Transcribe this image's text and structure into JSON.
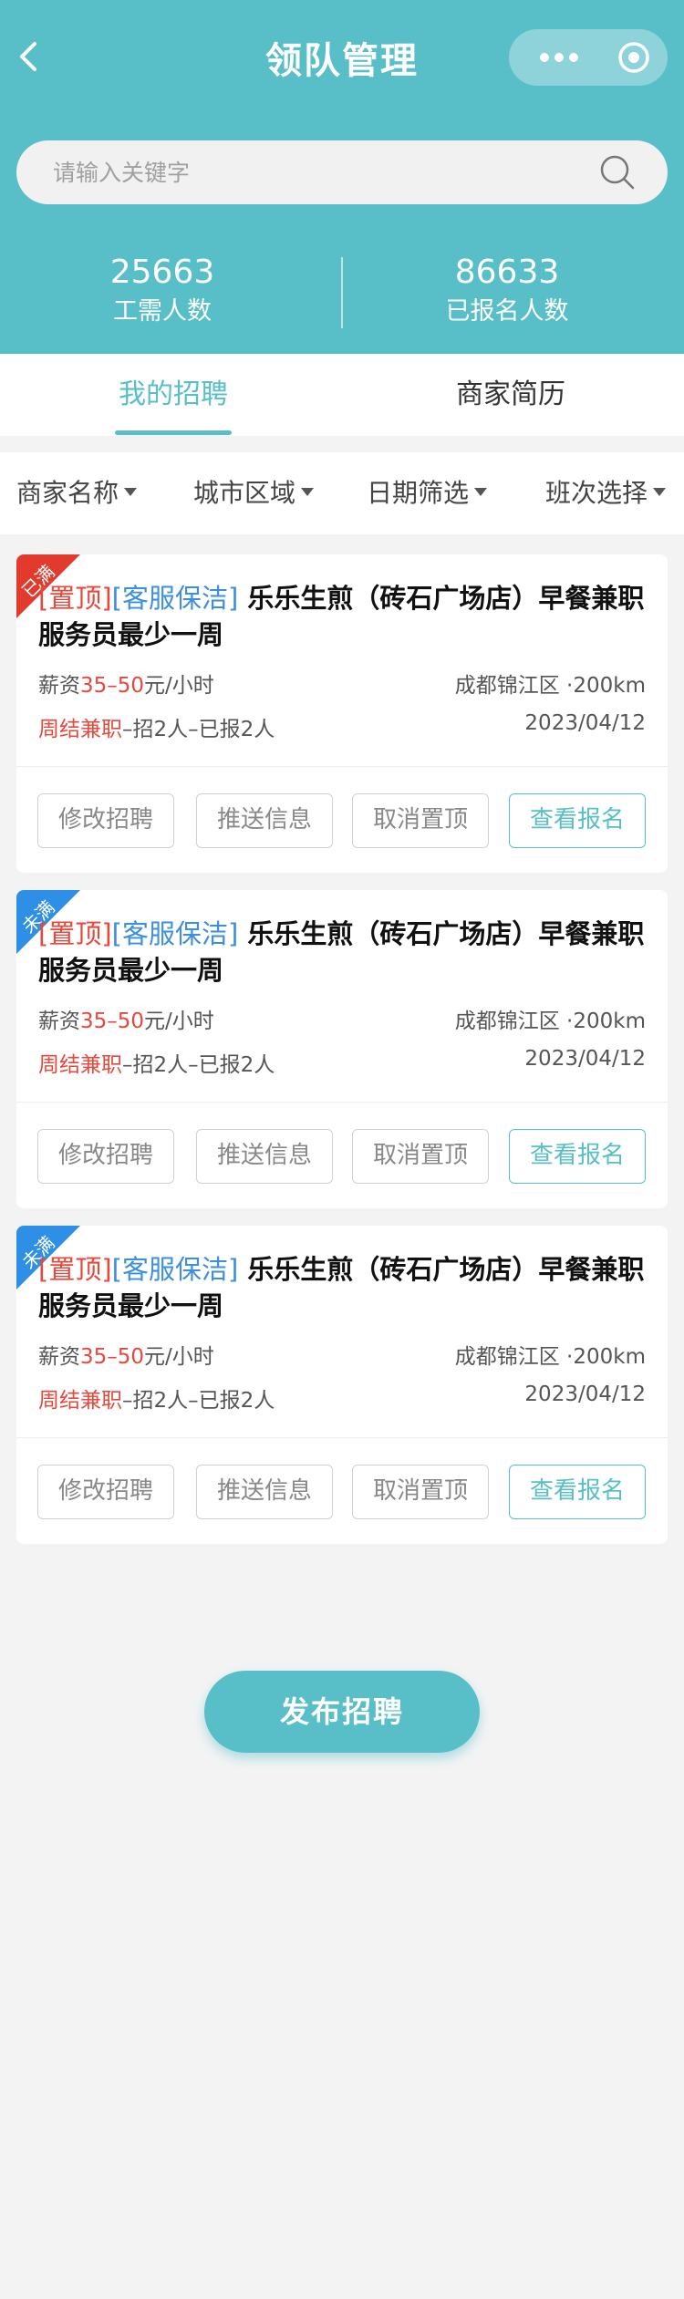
{
  "header": {
    "title": "领队管理",
    "back_icon": "chevron-left-icon",
    "more_icon": "more-dots-icon",
    "target_icon": "target-circle-icon",
    "bg_color": "#58bfc8"
  },
  "search": {
    "placeholder": "请输入关键字",
    "value": ""
  },
  "stats": [
    {
      "value": "25663",
      "label": "工需人数"
    },
    {
      "value": "86633",
      "label": "已报名人数"
    }
  ],
  "tabs": [
    {
      "label": "我的招聘",
      "active": true
    },
    {
      "label": "商家简历",
      "active": false
    }
  ],
  "filters": [
    {
      "label": "商家名称"
    },
    {
      "label": "城市区域"
    },
    {
      "label": "日期筛选"
    },
    {
      "label": "班次选择"
    }
  ],
  "cards": [
    {
      "ribbon": "已满",
      "ribbon_color": "#e23b2e",
      "top_tag": "[置顶]",
      "category": "[客服保洁]",
      "title": "乐乐生煎（砖石广场店）早餐兼职服务员最少一周",
      "salary_prefix": "薪资",
      "salary_range": "35–50",
      "salary_unit": "元/小时",
      "location": "成都锦江区 ·200km",
      "settle": "周结兼职",
      "recruit": "–招2人–已报2人",
      "date": "2023/04/12",
      "buttons": [
        "修改招聘",
        "推送信息",
        "取消置顶",
        "查看报名"
      ]
    },
    {
      "ribbon": "未满",
      "ribbon_color": "#2e8fe6",
      "top_tag": "[置顶]",
      "category": "[客服保洁]",
      "title": "乐乐生煎（砖石广场店）早餐兼职服务员最少一周",
      "salary_prefix": "薪资",
      "salary_range": "35–50",
      "salary_unit": "元/小时",
      "location": "成都锦江区 ·200km",
      "settle": "周结兼职",
      "recruit": "–招2人–已报2人",
      "date": "2023/04/12",
      "buttons": [
        "修改招聘",
        "推送信息",
        "取消置顶",
        "查看报名"
      ]
    },
    {
      "ribbon": "未满",
      "ribbon_color": "#2e8fe6",
      "top_tag": "[置顶]",
      "category": "[客服保洁]",
      "title": "乐乐生煎（砖石广场店）早餐兼职服务员最少一周",
      "salary_prefix": "薪资",
      "salary_range": "35–50",
      "salary_unit": "元/小时",
      "location": "成都锦江区 ·200km",
      "settle": "周结兼职",
      "recruit": "–招2人–已报2人",
      "date": "2023/04/12",
      "buttons": [
        "修改招聘",
        "推送信息",
        "取消置顶",
        "查看报名"
      ]
    }
  ],
  "publish_button": "发布招聘"
}
